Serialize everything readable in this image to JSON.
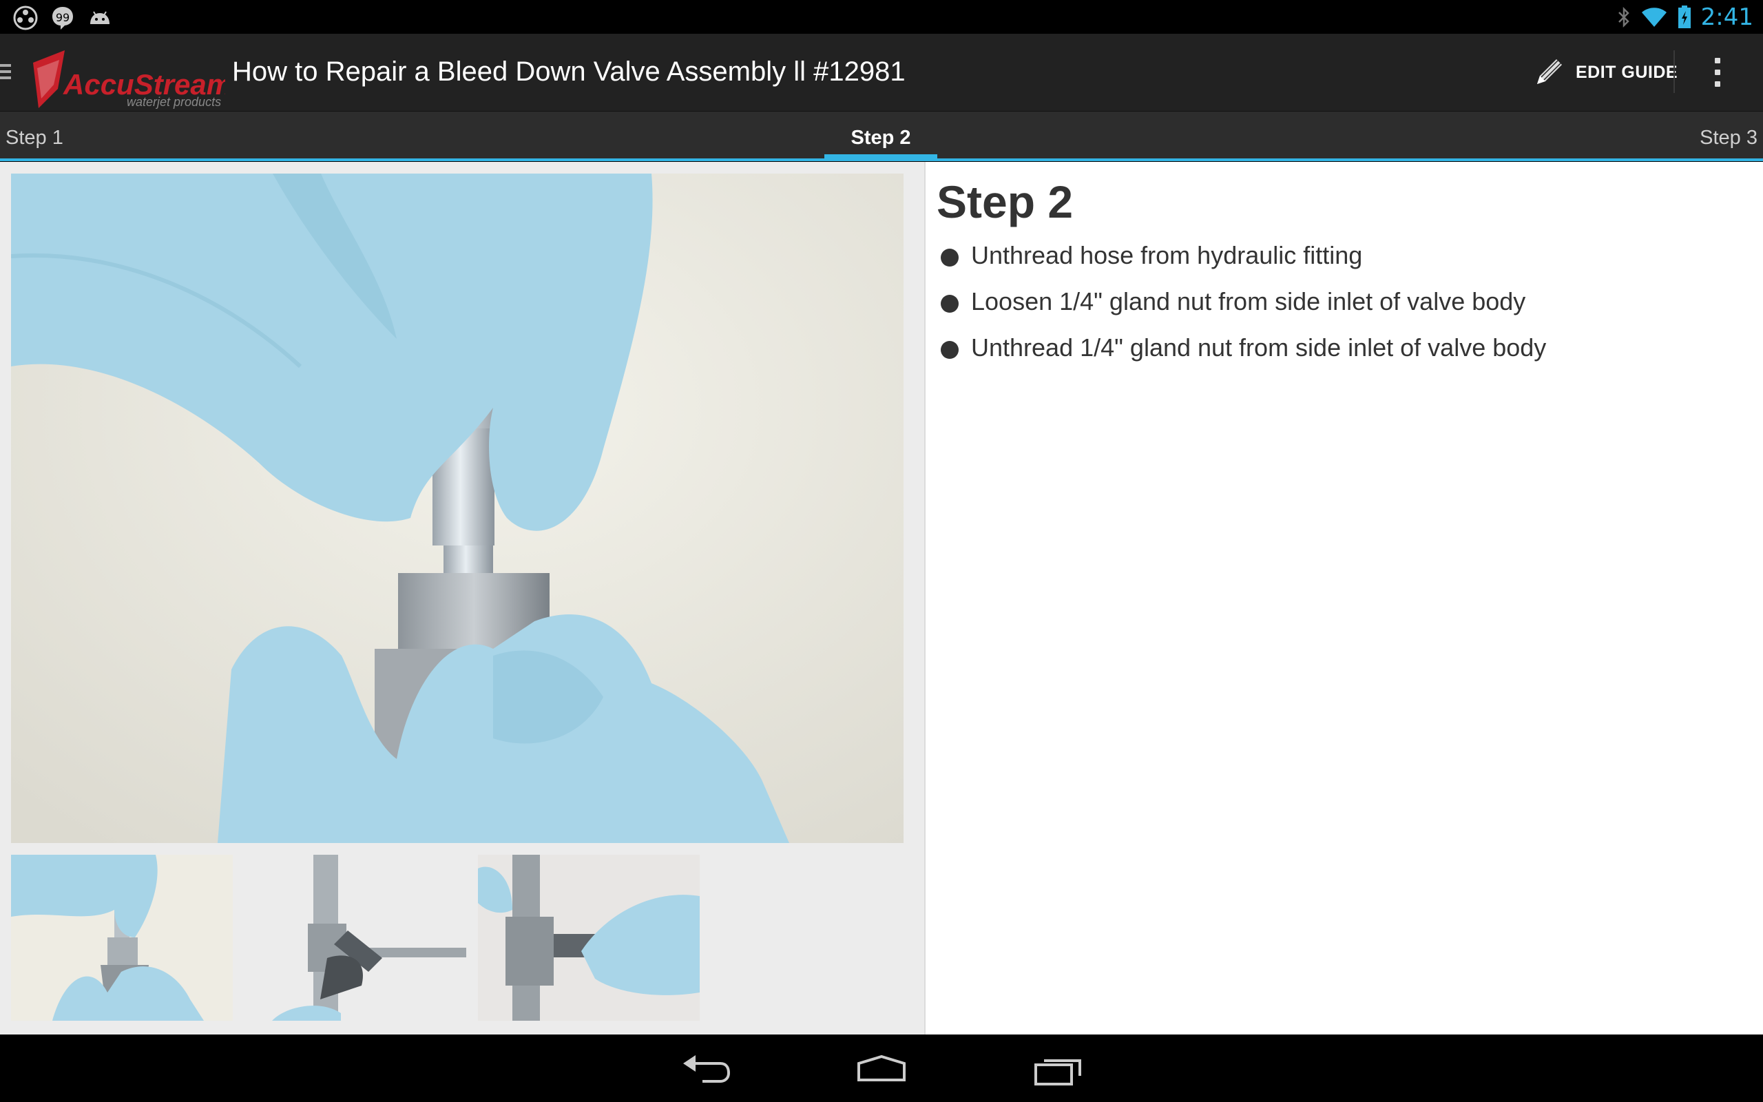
{
  "status_bar": {
    "time": "2:41",
    "left_icons": [
      "film-reel-icon",
      "chat-bubble-icon",
      "android-icon"
    ],
    "right_icons": [
      "bluetooth-icon",
      "wifi-icon",
      "battery-charging-icon"
    ]
  },
  "action_bar": {
    "logo_text": "AccuStream",
    "logo_subtext": "waterjet products",
    "title": "How to Repair a Bleed Down Valve Assembly ll #12981",
    "edit_label": "EDIT GUIDE"
  },
  "tabs": [
    {
      "label": "Step 1",
      "selected": false
    },
    {
      "label": "Step 2",
      "selected": true
    },
    {
      "label": "Step 3",
      "selected": false
    }
  ],
  "step": {
    "title": "Step 2",
    "bullets": [
      "Unthread hose from hydraulic fitting",
      "Loosen 1/4\" gland nut from side inlet of valve body",
      "Unthread 1/4\" gland nut from side inlet of valve body"
    ]
  },
  "images": {
    "main": "gloved-hands-threading-fitting-photo",
    "thumbnails": [
      "gloved-hands-fitting-thumbnail",
      "wrench-on-gland-nut-thumbnail",
      "hand-unthreading-gland-nut-thumbnail"
    ]
  },
  "colors": {
    "accent": "#33b5e5",
    "action_bar": "#222222",
    "tab_bar": "#2d2d2d",
    "logo_red": "#c8202a",
    "glove_blue": "#a6d3e6"
  },
  "nav_bar": [
    "back-icon",
    "home-icon",
    "recent-apps-icon"
  ]
}
